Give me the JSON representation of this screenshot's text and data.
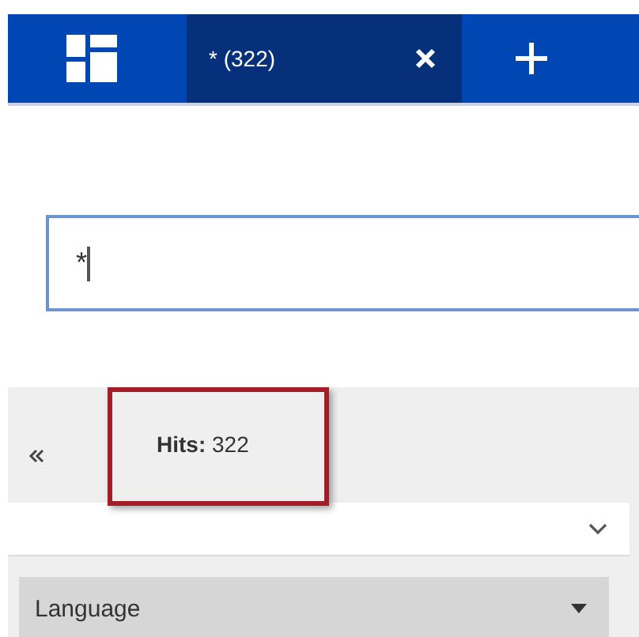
{
  "tabs": [
    {
      "label": "* (322)",
      "selected": true
    }
  ],
  "search": {
    "value": "*"
  },
  "results": {
    "hits": "**Hits:** 322",
    "highlighted": true
  },
  "filters": [
    {
      "label": "Language"
    }
  ]
}
